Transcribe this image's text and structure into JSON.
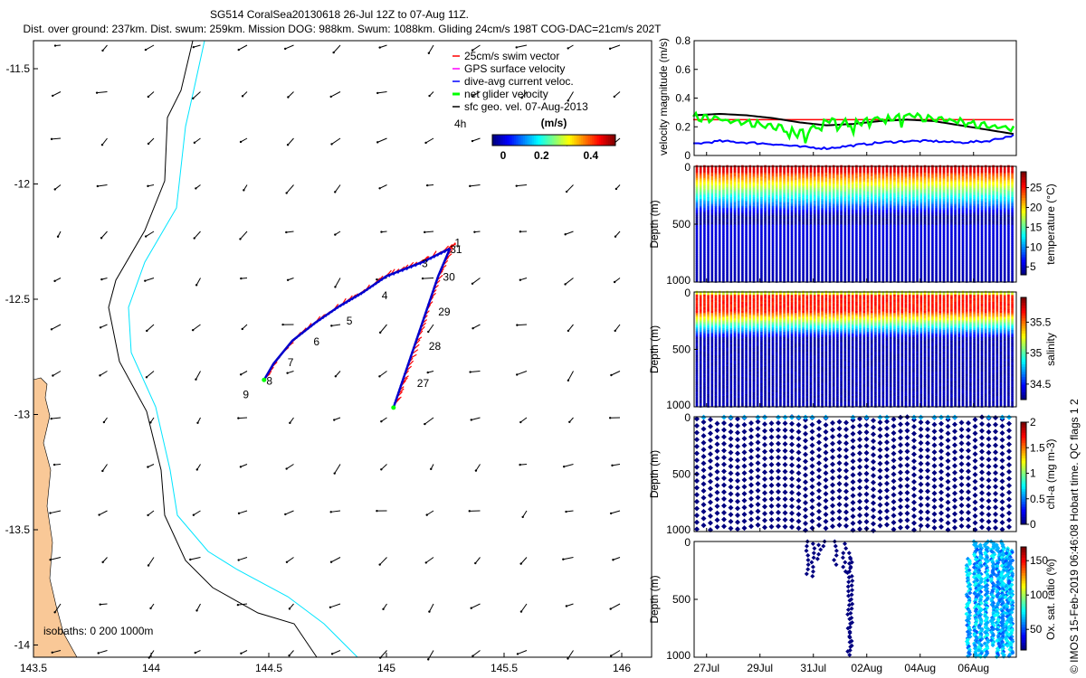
{
  "title": {
    "line1": "SG514 CoralSea20130618 26-Jul 12Z to 07-Aug 11Z.",
    "line2": "Dist. over ground: 237km. Dist. swum: 259km. Mission DOG: 988km. Swum: 1088km. Gliding 24cm/s 198T COG-DAC=21cm/s 202T"
  },
  "footer": "© IMOS 15-Feb-2019 06:46:08 Hobart time. QC flags 1  2",
  "chart_data": [
    {
      "type": "scatter",
      "name": "map",
      "xlim": [
        143.5,
        146.12
      ],
      "ylim": [
        -14.05,
        -11.38
      ],
      "xticks": [
        "143.5",
        "144",
        "144.5",
        "145",
        "145.5",
        "146"
      ],
      "yticks": [
        "-11.5",
        "-12",
        "-12.5",
        "-13",
        "-13.5",
        "-14"
      ],
      "legend": [
        "25cm/s swim vector",
        "GPS surface velocity",
        "dive-avg current veloc.",
        "net glider velocity",
        "sfc geo. vel. 07-Aug-2013"
      ],
      "legend_colors": [
        "#ff0000",
        "#ff00ff",
        "#0000ff",
        "#00ff00",
        "#000000"
      ],
      "colorbar": {
        "label": "(m/s)",
        "ticks": [
          "0",
          "0.2",
          "0.4"
        ],
        "range": [
          0,
          0.5
        ]
      },
      "scale_note": "4h",
      "isobath_label": "isobaths: 0   200  1000m",
      "track_leg1": [
        [
          145.27,
          -12.28
        ],
        [
          145.15,
          -12.34
        ],
        [
          145.0,
          -12.4
        ],
        [
          144.9,
          -12.47
        ],
        [
          144.8,
          -12.53
        ],
        [
          144.7,
          -12.6
        ],
        [
          144.6,
          -12.68
        ],
        [
          144.52,
          -12.78
        ],
        [
          144.48,
          -12.85
        ]
      ],
      "track_leg2": [
        [
          145.27,
          -12.28
        ],
        [
          145.22,
          -12.4
        ],
        [
          145.17,
          -12.55
        ],
        [
          145.12,
          -12.7
        ],
        [
          145.07,
          -12.85
        ],
        [
          145.03,
          -12.97
        ]
      ],
      "day_labels": [
        {
          "t": "1",
          "lon": 145.29,
          "lat": -12.27
        },
        {
          "t": "31",
          "lon": 145.27,
          "lat": -12.3
        },
        {
          "t": "3",
          "lon": 145.15,
          "lat": -12.36
        },
        {
          "t": "30",
          "lon": 145.24,
          "lat": -12.42
        },
        {
          "t": "4",
          "lon": 144.98,
          "lat": -12.5
        },
        {
          "t": "29",
          "lon": 145.22,
          "lat": -12.57
        },
        {
          "t": "5",
          "lon": 144.83,
          "lat": -12.61
        },
        {
          "t": "6",
          "lon": 144.69,
          "lat": -12.7
        },
        {
          "t": "28",
          "lon": 145.18,
          "lat": -12.72
        },
        {
          "t": "7",
          "lon": 144.58,
          "lat": -12.79
        },
        {
          "t": "8",
          "lon": 144.49,
          "lat": -12.87
        },
        {
          "t": "27",
          "lon": 145.13,
          "lat": -12.88
        },
        {
          "t": "9",
          "lon": 144.39,
          "lat": -12.93
        }
      ]
    },
    {
      "type": "line",
      "name": "velocity",
      "ylabel": "velocity magnitude (m/s)",
      "ylim": [
        0,
        0.8
      ],
      "yticks": [
        "0",
        "0.2",
        "0.4",
        "0.6",
        "0.8"
      ],
      "x_days_since_26Jul12Z": [
        0,
        1,
        2,
        3,
        4,
        5,
        6,
        7,
        8,
        9,
        10,
        11,
        12
      ],
      "series": [
        {
          "name": "swim",
          "color": "#ff0000",
          "values": [
            0.25,
            0.25,
            0.25,
            0.25,
            0.25,
            0.25,
            0.25,
            0.25,
            0.25,
            0.25,
            0.25,
            0.25,
            0.25
          ]
        },
        {
          "name": "sfc geo",
          "color": "#000000",
          "values": [
            0.28,
            0.29,
            0.28,
            0.26,
            0.23,
            0.21,
            0.22,
            0.24,
            0.25,
            0.24,
            0.21,
            0.18,
            0.15
          ]
        },
        {
          "name": "dive-avg",
          "color": "#0000ff",
          "values": [
            0.08,
            0.1,
            0.09,
            0.08,
            0.06,
            0.05,
            0.07,
            0.09,
            0.1,
            0.1,
            0.09,
            0.1,
            0.14
          ]
        },
        {
          "name": "net glider",
          "color": "#00ff00",
          "values": [
            0.27,
            0.25,
            0.23,
            0.2,
            0.15,
            0.24,
            0.22,
            0.26,
            0.28,
            0.26,
            0.24,
            0.2,
            0.2
          ]
        }
      ]
    },
    {
      "type": "scatter",
      "name": "temperature",
      "ylabel": "Depth (m)",
      "yticks": [
        "0",
        "500",
        "1000"
      ],
      "cbar_label": "temperature (°C)",
      "cbar_ticks": [
        "5",
        "10",
        "15",
        "20",
        "25"
      ],
      "crange": [
        3,
        29
      ]
    },
    {
      "type": "scatter",
      "name": "salinity",
      "ylabel": "Depth (m)",
      "yticks": [
        "0",
        "500",
        "1000"
      ],
      "cbar_label": "salinity",
      "cbar_ticks": [
        "34.5",
        "35",
        "35.5"
      ],
      "crange": [
        34.25,
        35.9
      ]
    },
    {
      "type": "scatter",
      "name": "chl",
      "ylabel": "Depth (m)",
      "yticks": [
        "0",
        "500",
        "1000"
      ],
      "cbar_label": "chl-a (mg m-3)",
      "cbar_ticks": [
        "0",
        "0.5",
        "1",
        "1.5",
        "2"
      ],
      "crange": [
        0,
        2
      ]
    },
    {
      "type": "scatter",
      "name": "oxygen",
      "ylabel": "Depth (m)",
      "yticks": [
        "0",
        "500",
        "1000"
      ],
      "cbar_label": "Ox. sat. ratio (%)",
      "cbar_ticks": [
        "50",
        "100",
        "150"
      ],
      "crange": [
        20,
        170
      ]
    }
  ],
  "xdate_ticks": [
    "27Jul",
    "29Jul",
    "31Jul",
    "02Aug",
    "04Aug",
    "06Aug"
  ]
}
